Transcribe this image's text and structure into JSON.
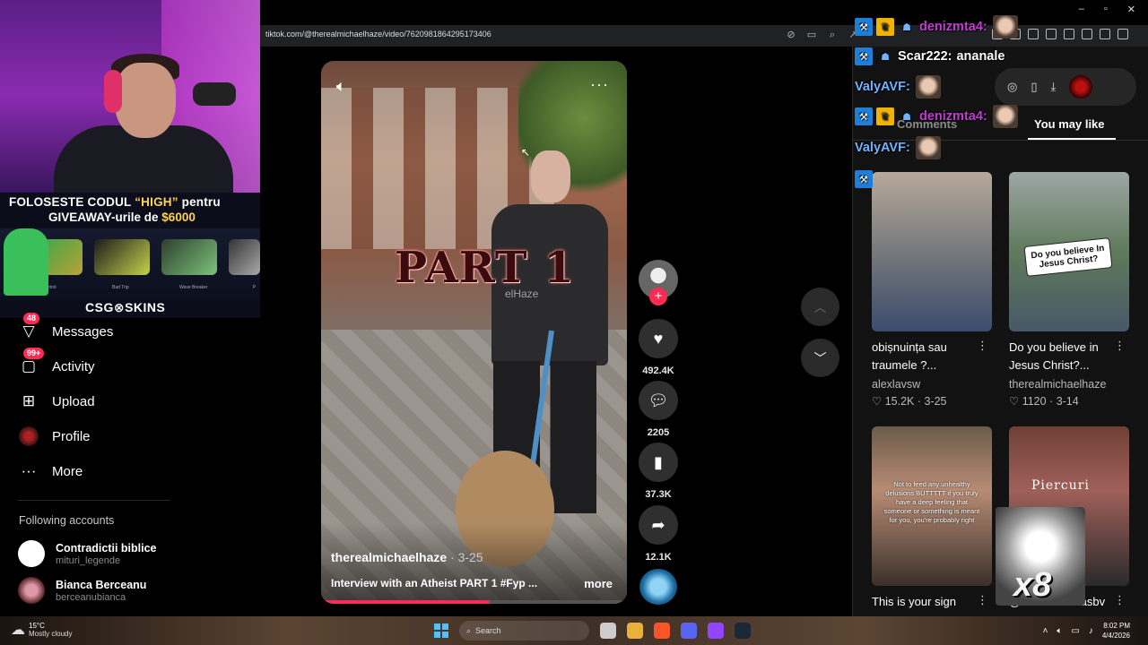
{
  "browser": {
    "url": "tiktok.com/@therealmichaelhaze/video/7620981864295173406",
    "window_controls": [
      "–",
      "▫",
      "✕"
    ]
  },
  "stream_overlay": {
    "promo_line1_prefix": "FOLOSESTE CODUL ",
    "promo_code": "“HIGH”",
    "promo_line1_suffix": " pentru",
    "promo_line2_prefix": "GIVEAWAY-urile de ",
    "promo_amount": "$6000",
    "skin_labels": [
      "ontrol",
      "Bad Trip",
      "Wave Breaker",
      "P"
    ],
    "brand": "CSG⊗SKINS"
  },
  "sidebar": {
    "items": [
      {
        "label": "Messages",
        "badge": "48",
        "icon": "send-icon"
      },
      {
        "label": "Activity",
        "badge": "99+",
        "icon": "inbox-icon"
      },
      {
        "label": "Upload",
        "badge": "",
        "icon": "plus-square-icon"
      },
      {
        "label": "Profile",
        "badge": "",
        "icon": "avatar-icon"
      },
      {
        "label": "More",
        "badge": "",
        "icon": "more-icon"
      }
    ],
    "following_title": "Following accounts",
    "following": [
      {
        "name": "Contradictii biblice",
        "handle": "mituri_legende"
      },
      {
        "name": "Bianca Berceanu",
        "handle": "berceanubianca"
      }
    ]
  },
  "video": {
    "overlay_title": "PART 1",
    "watermark": "elHaze",
    "author": "therealmichaelhaze",
    "date": " · 3-25",
    "caption": "Interview with an Atheist PART 1 #Fyp ...",
    "more_label": "more",
    "progress": 0.55
  },
  "actions": {
    "likes": "492.4K",
    "comments": "2205",
    "saves": "37.3K",
    "shares": "12.1K"
  },
  "right_panel": {
    "tab_comments": "Comments",
    "tab_you_may_like": "You may like",
    "cards": [
      {
        "title": "obișnuința sau traumele ?...",
        "author": "alexlavsw",
        "likes": "15.2K",
        "date": "3-25"
      },
      {
        "title": "Do you believe in Jesus Christ?...",
        "author": "therealmichaelhaze",
        "likes": "1120",
        "date": "3-14",
        "thumb_text": "Do you believe In Jesus Christ?"
      },
      {
        "title": "This is your sign",
        "author": "",
        "likes": "",
        "date": "",
        "thumb_text": "Not to feed any unhealthy delusions BUTTTTT if you truly have a deep feeling that someone or something is meant for you, you're probably right"
      },
      {
        "title": "@boavbiercinasbv",
        "author": "",
        "likes": "",
        "date": "",
        "thumb_text": "Piercuri"
      }
    ]
  },
  "chat": [
    {
      "user": "denizmta4:",
      "message": "",
      "color": "#c23bd3"
    },
    {
      "user": "Scar222:",
      "message": "ananale",
      "color": "#ffffff"
    },
    {
      "user": "ValyAVF:",
      "message": "",
      "color": "#6fb4ff"
    },
    {
      "user": "denizmta4:",
      "message": "",
      "color": "#c23bd3"
    },
    {
      "user": "ValyAVF:",
      "message": "",
      "color": "#6fb4ff"
    }
  ],
  "emote_multiplier": "x8",
  "taskbar": {
    "temp": "15°C",
    "weather": "Mostly cloudy",
    "search": "Search",
    "time": "8:02 PM",
    "date": "4/4/2026"
  },
  "colors": {
    "accent": "#fe2c55",
    "bg": "#000000",
    "panel": "#121212"
  }
}
